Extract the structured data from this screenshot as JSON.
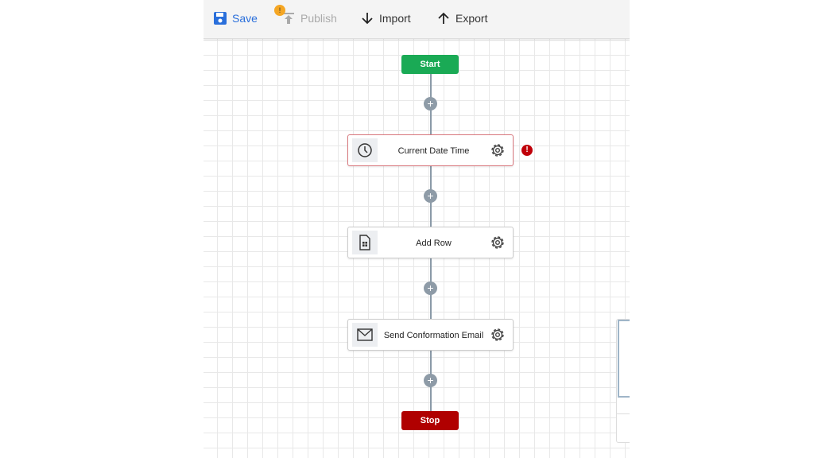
{
  "toolbar": {
    "save": "Save",
    "publish": "Publish",
    "publish_badge": "!",
    "import": "Import",
    "export": "Export"
  },
  "flow": {
    "start": "Start",
    "stop": "Stop",
    "nodes": [
      {
        "label": "Current Date Time",
        "icon": "clock-icon",
        "error": true
      },
      {
        "label": "Add Row",
        "icon": "spreadsheet-file-icon",
        "error": false
      },
      {
        "label": "Send Conformation Email",
        "icon": "mail-icon",
        "error": false
      }
    ],
    "error_badge": "!"
  },
  "colors": {
    "start": "#1aaa55",
    "stop": "#b00000",
    "save": "#2a6fdb",
    "warning": "#f5a623",
    "error": "#c0000a"
  }
}
